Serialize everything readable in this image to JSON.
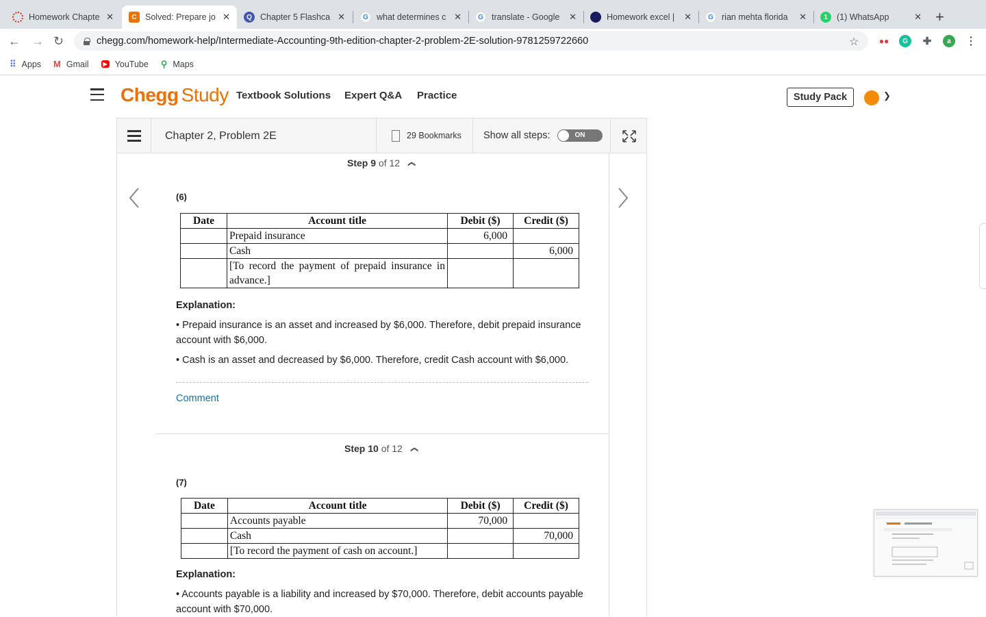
{
  "browser": {
    "tabs": [
      {
        "title": "Homework Chapte",
        "favicon": "chegg-ring-icon",
        "color": "#e0301e"
      },
      {
        "title": "Solved: Prepare jo",
        "favicon": "chegg-c-icon",
        "color": "#eb7100",
        "active": true
      },
      {
        "title": "Chapter 5 Flashca",
        "favicon": "quizlet-q-icon",
        "color": "#4257b2"
      },
      {
        "title": "what determines c",
        "favicon": "google-g-icon",
        "color": "#4285f4"
      },
      {
        "title": "translate - Google",
        "favicon": "google-g-icon",
        "color": "#4285f4"
      },
      {
        "title": "Homework excel |",
        "favicon": "brainly-icon",
        "color": "#1a1a5e"
      },
      {
        "title": "rian mehta florida",
        "favicon": "google-g-icon",
        "color": "#4285f4"
      },
      {
        "title": "(1) WhatsApp",
        "favicon": "whatsapp-icon",
        "color": "#25d366",
        "badge": "1"
      }
    ],
    "url": "chegg.com/homework-help/Intermediate-Accounting-9th-edition-chapter-2-problem-2E-solution-9781259722660",
    "profile_initial": "a",
    "bookmarks": [
      {
        "label": "Apps"
      },
      {
        "label": "Gmail"
      },
      {
        "label": "YouTube"
      },
      {
        "label": "Maps"
      }
    ]
  },
  "chegg": {
    "logo_main": "Chegg",
    "logo_sub": "Study",
    "nav": [
      "Textbook Solutions",
      "Expert Q&A",
      "Practice"
    ],
    "study_pack": "Study Pack",
    "brand_color": "#eb7100"
  },
  "problem": {
    "title": "Chapter 2, Problem 2E",
    "bookmarks": "29 Bookmarks",
    "show_steps": "Show all steps:",
    "toggle": "ON"
  },
  "steps": [
    {
      "current": "Step 9",
      "total": "of 12",
      "section": "(6)",
      "headers": [
        "Date",
        "Account title",
        "Debit ($)",
        "Credit ($)"
      ],
      "rows": [
        [
          "",
          "Prepaid insurance",
          "6,000",
          ""
        ],
        [
          "",
          "Cash",
          "",
          "6,000"
        ],
        [
          "",
          "[To record the payment of prepaid insurance in advance.]",
          "",
          ""
        ]
      ],
      "explanation_title": "Explanation:",
      "explanations": [
        "• Prepaid insurance is an asset and increased by $6,000. Therefore, debit prepaid insurance account with $6,000.",
        "• Cash is an asset and decreased by $6,000. Therefore, credit Cash account with $6,000."
      ],
      "comment": "Comment"
    },
    {
      "current": "Step 10",
      "total": "of 12",
      "section": "(7)",
      "headers": [
        "Date",
        "Account title",
        "Debit ($)",
        "Credit ($)"
      ],
      "rows": [
        [
          "",
          "Accounts payable",
          "70,000",
          ""
        ],
        [
          "",
          "Cash",
          "",
          "70,000"
        ],
        [
          "",
          "[To record the payment of cash on account.]",
          "",
          ""
        ]
      ],
      "explanation_title": "Explanation:",
      "explanations": [
        "• Accounts payable is a liability and increased by $70,000. Therefore, debit accounts payable account with $70,000."
      ]
    }
  ]
}
